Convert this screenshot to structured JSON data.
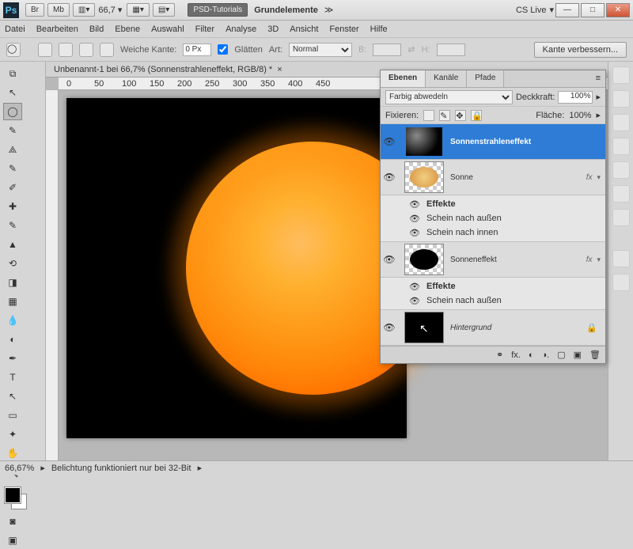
{
  "titlebar": {
    "zoom": "66,7",
    "breadcrumb1": "PSD-Tutorials",
    "breadcrumb2": "Grundelemente",
    "cslive": "CS Live"
  },
  "menu": [
    "Datei",
    "Bearbeiten",
    "Bild",
    "Ebene",
    "Auswahl",
    "Filter",
    "Analyse",
    "3D",
    "Ansicht",
    "Fenster",
    "Hilfe"
  ],
  "options": {
    "weiche": "Weiche Kante:",
    "weiche_val": "0 Px",
    "glatten": "Glätten",
    "art": "Art:",
    "art_val": "Normal",
    "b": "B:",
    "h": "H:",
    "improve": "Kante verbessern..."
  },
  "doc": {
    "tab": "Unbenannt-1 bei 66,7% (Sonnenstrahleneffekt, RGB/8) *"
  },
  "ruler": [
    "0",
    "50",
    "100",
    "150",
    "200",
    "250",
    "300",
    "350",
    "400",
    "450"
  ],
  "panel": {
    "tabs": [
      "Ebenen",
      "Kanäle",
      "Pfade"
    ],
    "blend": "Farbig abwedeln",
    "opacity_lbl": "Deckkraft:",
    "opacity": "100%",
    "lock_lbl": "Fixieren:",
    "fill_lbl": "Fläche:",
    "fill": "100%",
    "layers": [
      {
        "name": "Sonnenstrahleneffekt",
        "selected": true,
        "thumb": "clouds"
      },
      {
        "name": "Sonne",
        "fx": true,
        "thumb": "sun",
        "effects": [
          "Schein nach außen",
          "Schein nach innen"
        ]
      },
      {
        "name": "Sonneneffekt",
        "fx": true,
        "thumb": "black",
        "effects": [
          "Schein nach außen"
        ]
      },
      {
        "name": "Hintergrund",
        "locked": true,
        "thumb": "solid",
        "italic": true
      }
    ],
    "effects_lbl": "Effekte"
  },
  "status": {
    "zoom": "66,67%",
    "msg": "Belichtung funktioniert nur bei 32-Bit"
  },
  "tools": [
    "▭",
    "↖",
    "◌",
    "✎",
    "✂",
    "⊕",
    "⌕",
    "✏",
    "⧉",
    "⌫",
    "◑",
    "◐",
    "✒",
    "♨",
    "⬚",
    "⇅",
    "✐",
    "T",
    "↖",
    "▢",
    "✋",
    "⬛",
    "🔍"
  ]
}
